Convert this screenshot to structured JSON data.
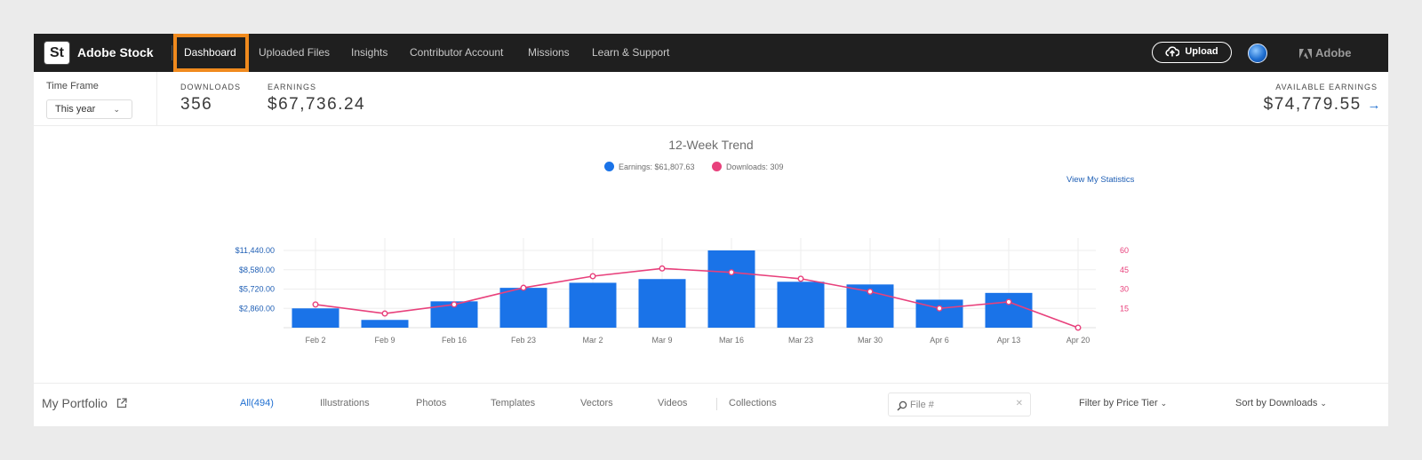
{
  "nav": {
    "logo": "St",
    "brand": "Adobe Stock",
    "links": [
      "Dashboard",
      "Uploaded Files",
      "Insights",
      "Contributor Account",
      "Missions",
      "Learn & Support"
    ],
    "upload_label": "Upload",
    "adobe_label": "Adobe"
  },
  "stats": {
    "timeframe_label": "Time Frame",
    "timeframe_value": "This year",
    "downloads_label": "DOWNLOADS",
    "downloads_value": "356",
    "earnings_label": "EARNINGS",
    "earnings_value": "$67,736.24",
    "available_label": "AVAILABLE EARNINGS",
    "available_value": "$74,779.55",
    "arrow": "→"
  },
  "chart": {
    "title": "12-Week Trend",
    "legend_earnings": "Earnings: $61,807.63",
    "legend_downloads": "Downloads: 309",
    "view_stats": "View My Statistics"
  },
  "colors": {
    "earnings": "#1a73e8",
    "downloads": "#e8417c",
    "highlight": "#f08a1e",
    "nav_bg": "#1f1f1f"
  },
  "chart_data": {
    "type": "bar",
    "categories": [
      "Feb 2",
      "Feb 9",
      "Feb 16",
      "Feb 23",
      "Mar 2",
      "Mar 9",
      "Mar 16",
      "Mar 23",
      "Mar 30",
      "Apr 6",
      "Apr 13",
      "Apr 20"
    ],
    "series": [
      {
        "name": "Earnings: $61,807.63",
        "axis": "left",
        "type": "bar",
        "values": [
          2860,
          1150,
          3900,
          5900,
          6650,
          7200,
          11440,
          6800,
          6400,
          4150,
          5150,
          0
        ]
      },
      {
        "name": "Downloads: 309",
        "axis": "right",
        "type": "line",
        "values": [
          18,
          11,
          18,
          31,
          40,
          46,
          43,
          38,
          28,
          15,
          20,
          0
        ]
      }
    ],
    "y_left": {
      "ticks": [
        2860,
        5720,
        8580,
        11440
      ],
      "tick_labels": [
        "$2,860.00",
        "$5,720.00",
        "$8,580.00",
        "$11,440.00"
      ],
      "range": [
        0,
        11440
      ]
    },
    "y_right": {
      "ticks": [
        15,
        30,
        45,
        60
      ],
      "tick_labels": [
        "15",
        "30",
        "45",
        "60"
      ],
      "range": [
        0,
        60
      ]
    },
    "grid": true,
    "legend": "top-center"
  },
  "portfolio": {
    "title": "My Portfolio",
    "tabs": [
      "All(494)",
      "Illustrations",
      "Photos",
      "Templates",
      "Vectors",
      "Videos",
      "Collections"
    ],
    "search_placeholder": "File #",
    "filter_label": "Filter by Price Tier",
    "sort_label": "Sort by Downloads"
  }
}
